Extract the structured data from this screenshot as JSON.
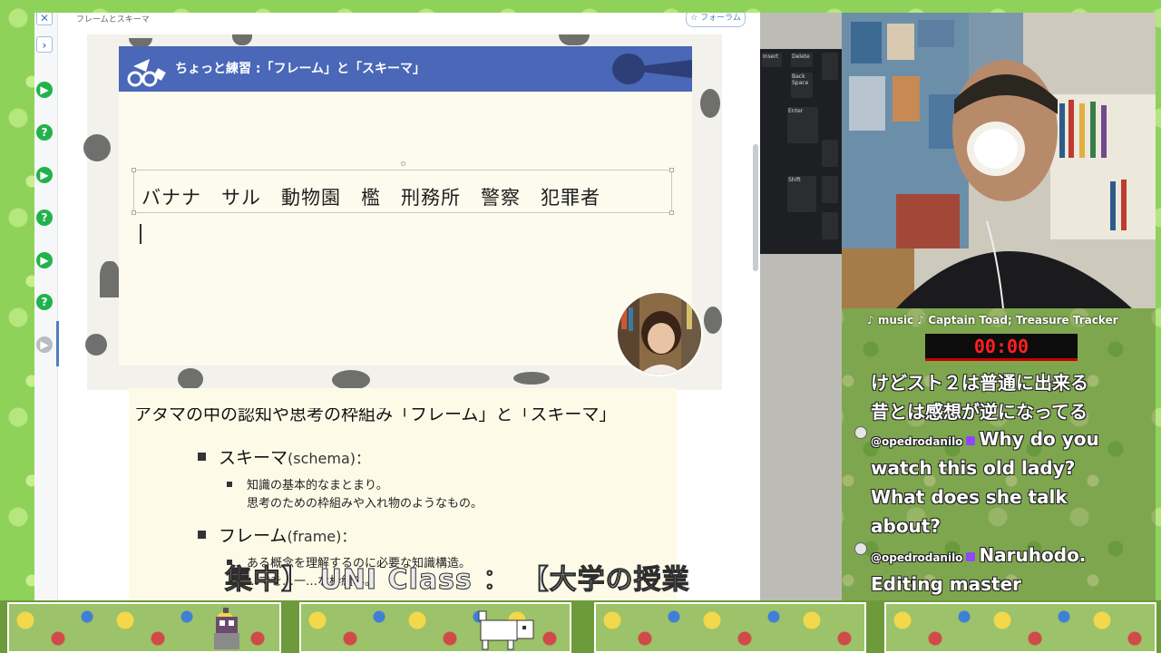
{
  "browser": {
    "breadcrumb": "フレームとスキーマ",
    "forum_button": "☆ フォーラム",
    "rail": {
      "close_glyph": "✕",
      "expand_glyph": "›",
      "play_glyph": "▶",
      "quiz_glyph": "?"
    }
  },
  "slide": {
    "title": "ちょっと練習 :「フレーム」と「スキーマ」",
    "words": "バナナ　サル　動物園　檻　刑務所　警察　犯罪者"
  },
  "notes": {
    "heading": "アタマの中の認知や思考の枠組み「フレーム」と「スキーマ」",
    "schema_label": "スキーマ",
    "schema_en": "(schema)：",
    "schema_desc_1": "知識の基本的なまとまり。",
    "schema_desc_2": "思考のための枠組みや入れ物のようなもの。",
    "frame_label": "フレーム",
    "frame_en": "(frame)：",
    "frame_desc_1": "ある概念を理解するのに必要な知識構造。",
    "frame_desc_2": "…マを…一…な枠組み。"
  },
  "overlay": {
    "title": "集中】 UNI Class ： 【大学の授業"
  },
  "stream": {
    "music": "♪ music ♪ Captain Toad; Treasure Tracker",
    "timer": "00:00"
  },
  "chat": {
    "line1": "けどスト２は普通に出来る",
    "line2": "昔とは感想が逆になってる",
    "msg1_user": "@opedrodanilo",
    "msg1_text_1": "Why do you",
    "msg1_text_2": "watch this old lady?",
    "msg1_text_3": "What does she talk",
    "msg1_text_4": "about?",
    "msg2_user": "@opedrodanilo",
    "msg2_text_1": "Naruhodo.",
    "msg2_text_2": "Editing master"
  },
  "colors": {
    "slide_header": "#4a67b8",
    "slide_bg": "#fcfbee",
    "accent_green": "#22b24c",
    "timer_red": "#ff2020",
    "stream_bg": "#8fd25a"
  }
}
